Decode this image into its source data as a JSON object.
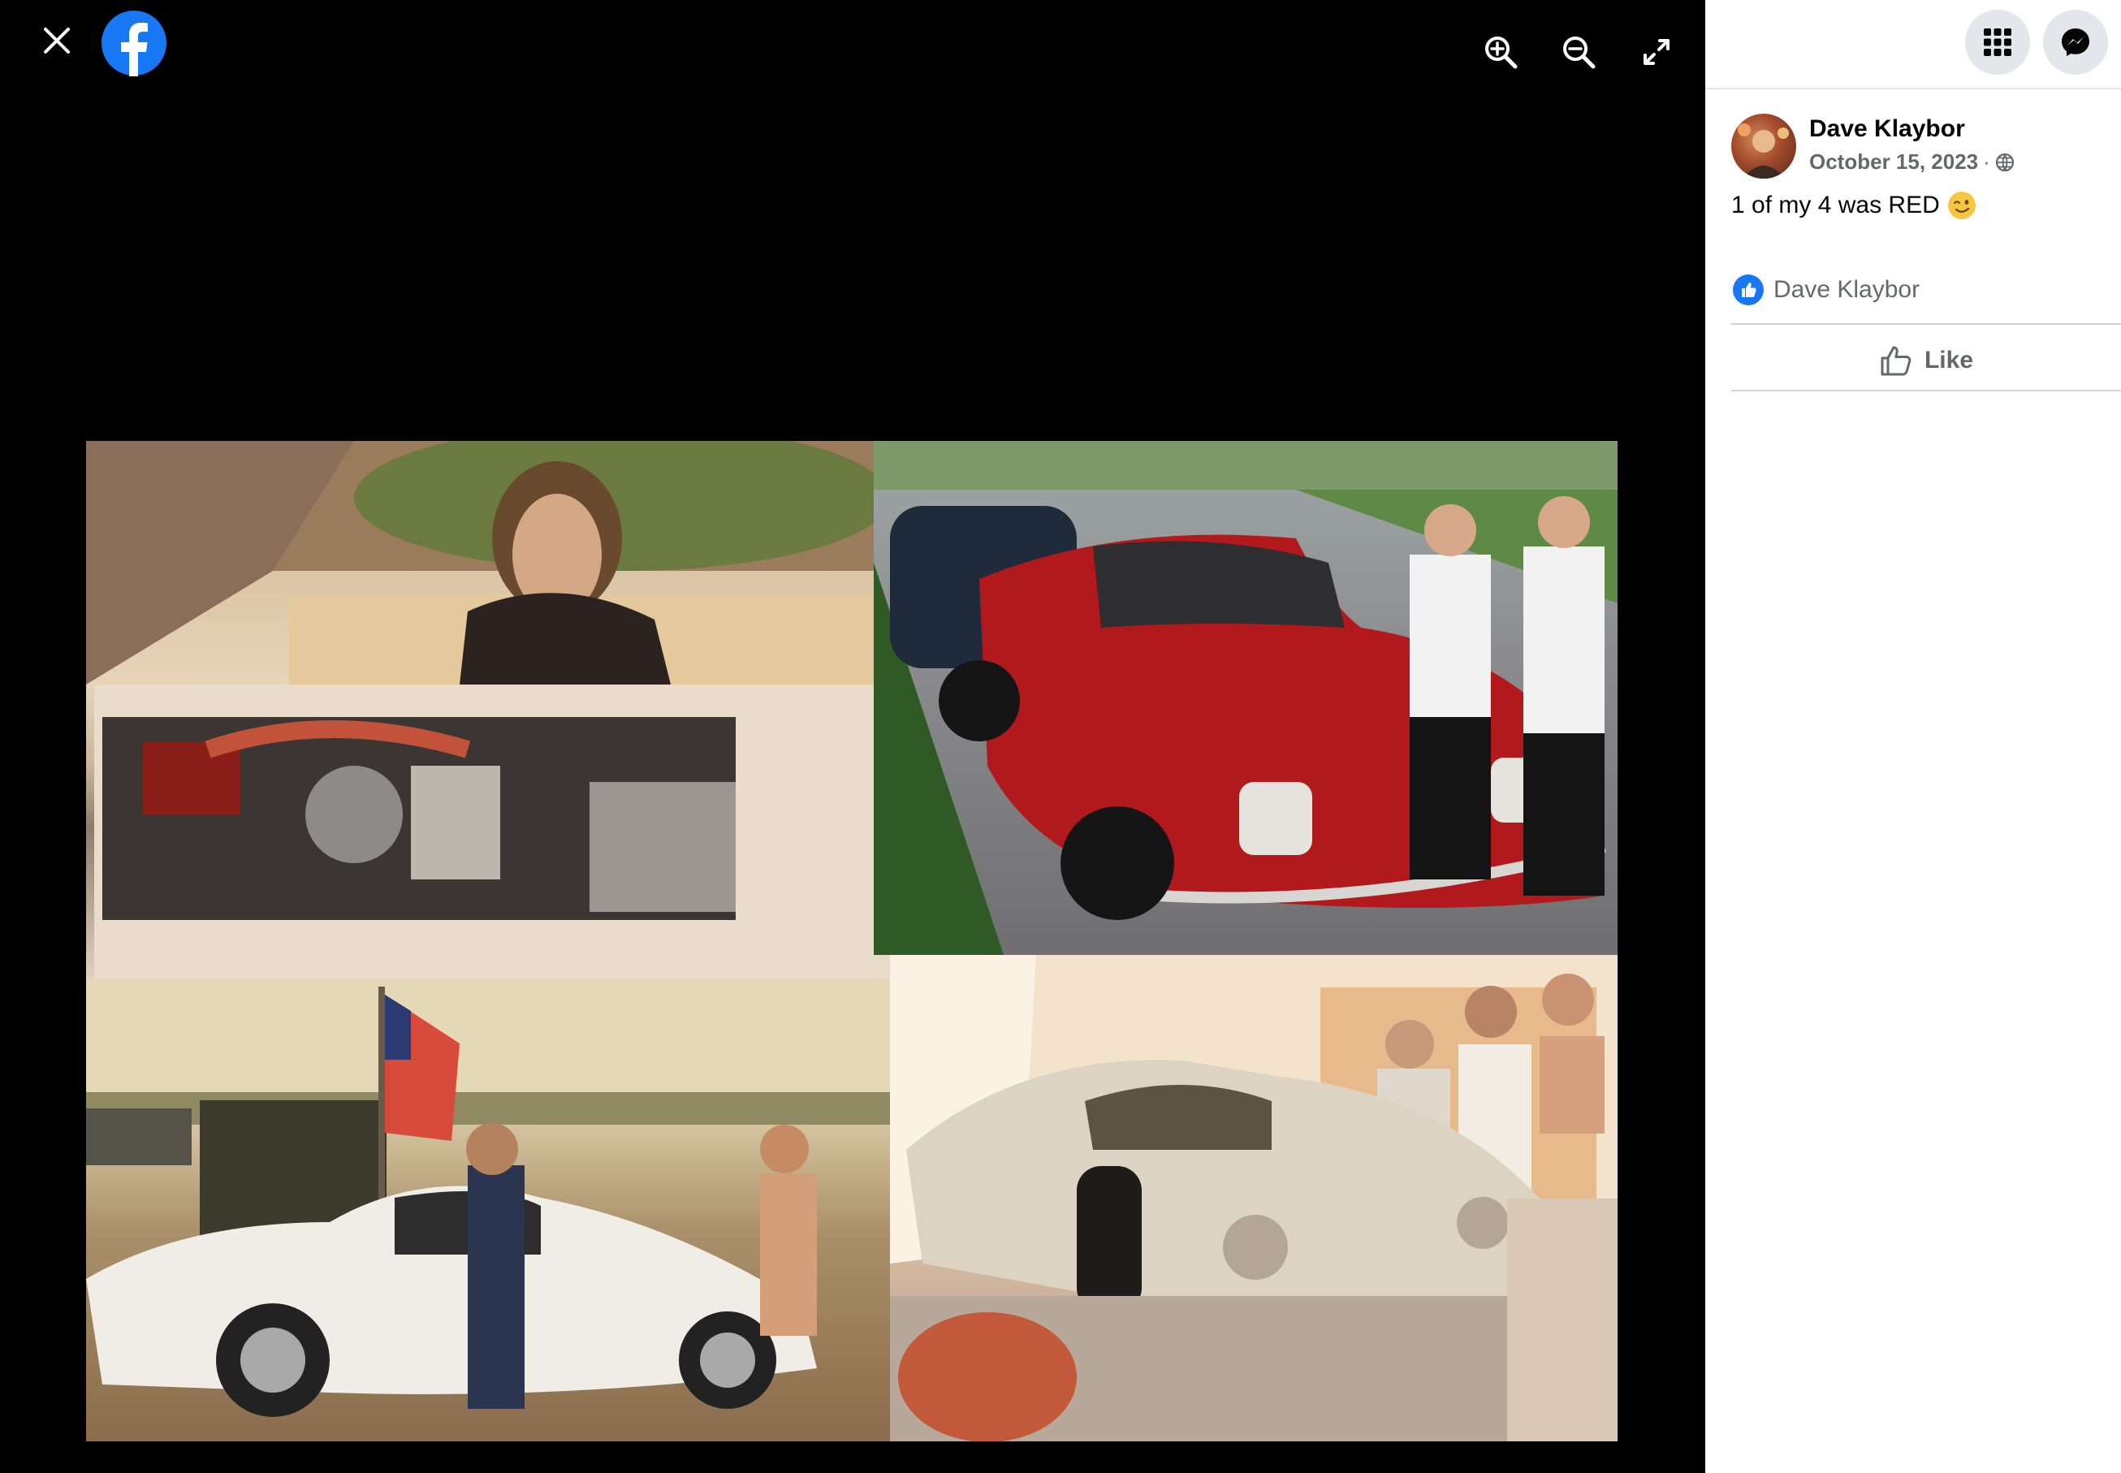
{
  "viewer": {
    "icons": {
      "close": "close-icon",
      "logo": "facebook-logo-icon",
      "zoom_in": "zoom-in-icon",
      "zoom_out": "zoom-out-icon",
      "fullscreen": "fullscreen-icon"
    }
  },
  "sidebar": {
    "icons": {
      "menu": "grid-menu-icon",
      "messenger": "messenger-icon"
    },
    "post": {
      "author": "Dave Klaybor",
      "date": "October 15, 2023",
      "separator": "·",
      "audience_icon": "globe-icon",
      "text": "1 of my 4 was RED",
      "emoji": "wink-emoji"
    },
    "reactions": {
      "icon": "like-reaction-icon",
      "names": "Dave Klaybor"
    },
    "actions": {
      "like_label": "Like"
    }
  },
  "colors": {
    "brand": "#1877f2",
    "secondary_text": "#65676b",
    "viewer_bg": "#000000",
    "sidebar_bg": "#ffffff"
  }
}
